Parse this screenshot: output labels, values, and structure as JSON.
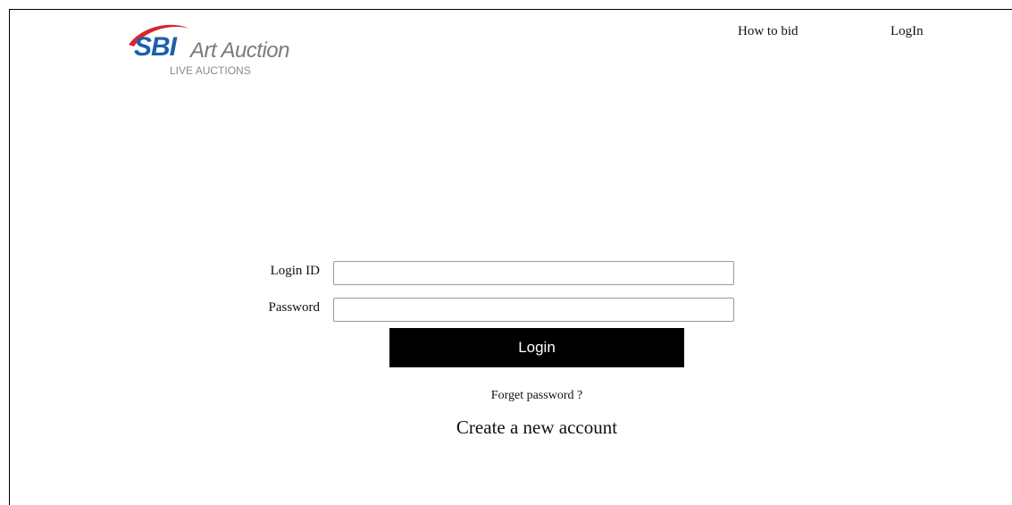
{
  "header": {
    "logo": {
      "brand": "SBI",
      "name": "Art Auction",
      "subtitle": "LIVE AUCTIONS",
      "icon": "sbi-swoosh-logo",
      "brand_color": "#1c5fae",
      "accent_color": "#d7262e"
    },
    "nav": {
      "how_to_bid": "How to bid",
      "login": "LogIn"
    }
  },
  "login_form": {
    "login_id_label": "Login ID",
    "login_id_value": "",
    "password_label": "Password",
    "password_value": "",
    "submit_label": "Login",
    "submit_color": "#000000",
    "forget_password": "Forget password ?",
    "create_account": "Create a new account"
  }
}
